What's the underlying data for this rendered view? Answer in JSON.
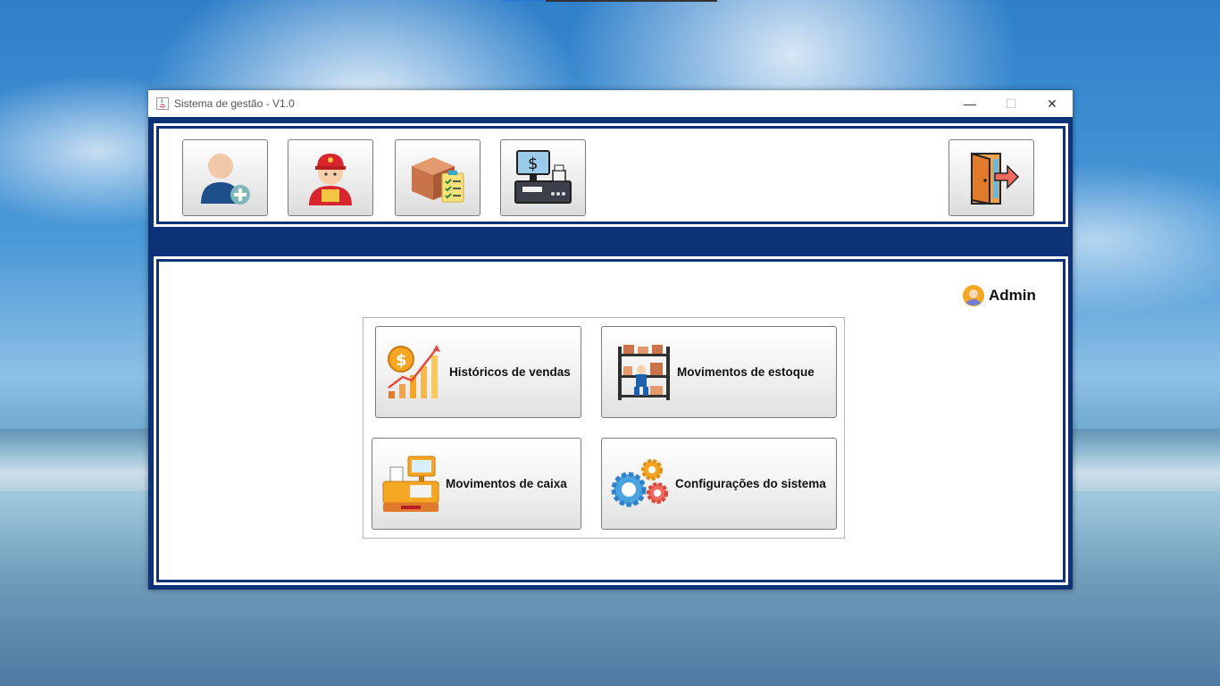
{
  "window": {
    "title": "Sistema de gestão  - V1.0",
    "controls": {
      "minimize": "—",
      "maximize": "☐",
      "close": "✕"
    }
  },
  "toolbar": {
    "buttons": [
      {
        "icon": "add-user-icon"
      },
      {
        "icon": "employee-icon"
      },
      {
        "icon": "product-box-icon"
      },
      {
        "icon": "cash-register-pos-icon"
      },
      {
        "icon": "exit-door-icon"
      }
    ]
  },
  "user": {
    "name": "Admin",
    "icon": "user-avatar-icon"
  },
  "menu": {
    "sales_history": "Históricos de vendas",
    "stock_movements": "Movimentos  de estoque",
    "cash_movements": "Movimentos de caixa",
    "system_settings": "Configurações do sistema"
  },
  "colors": {
    "frame": "#0d3277",
    "accent_orange": "#f5a623"
  }
}
